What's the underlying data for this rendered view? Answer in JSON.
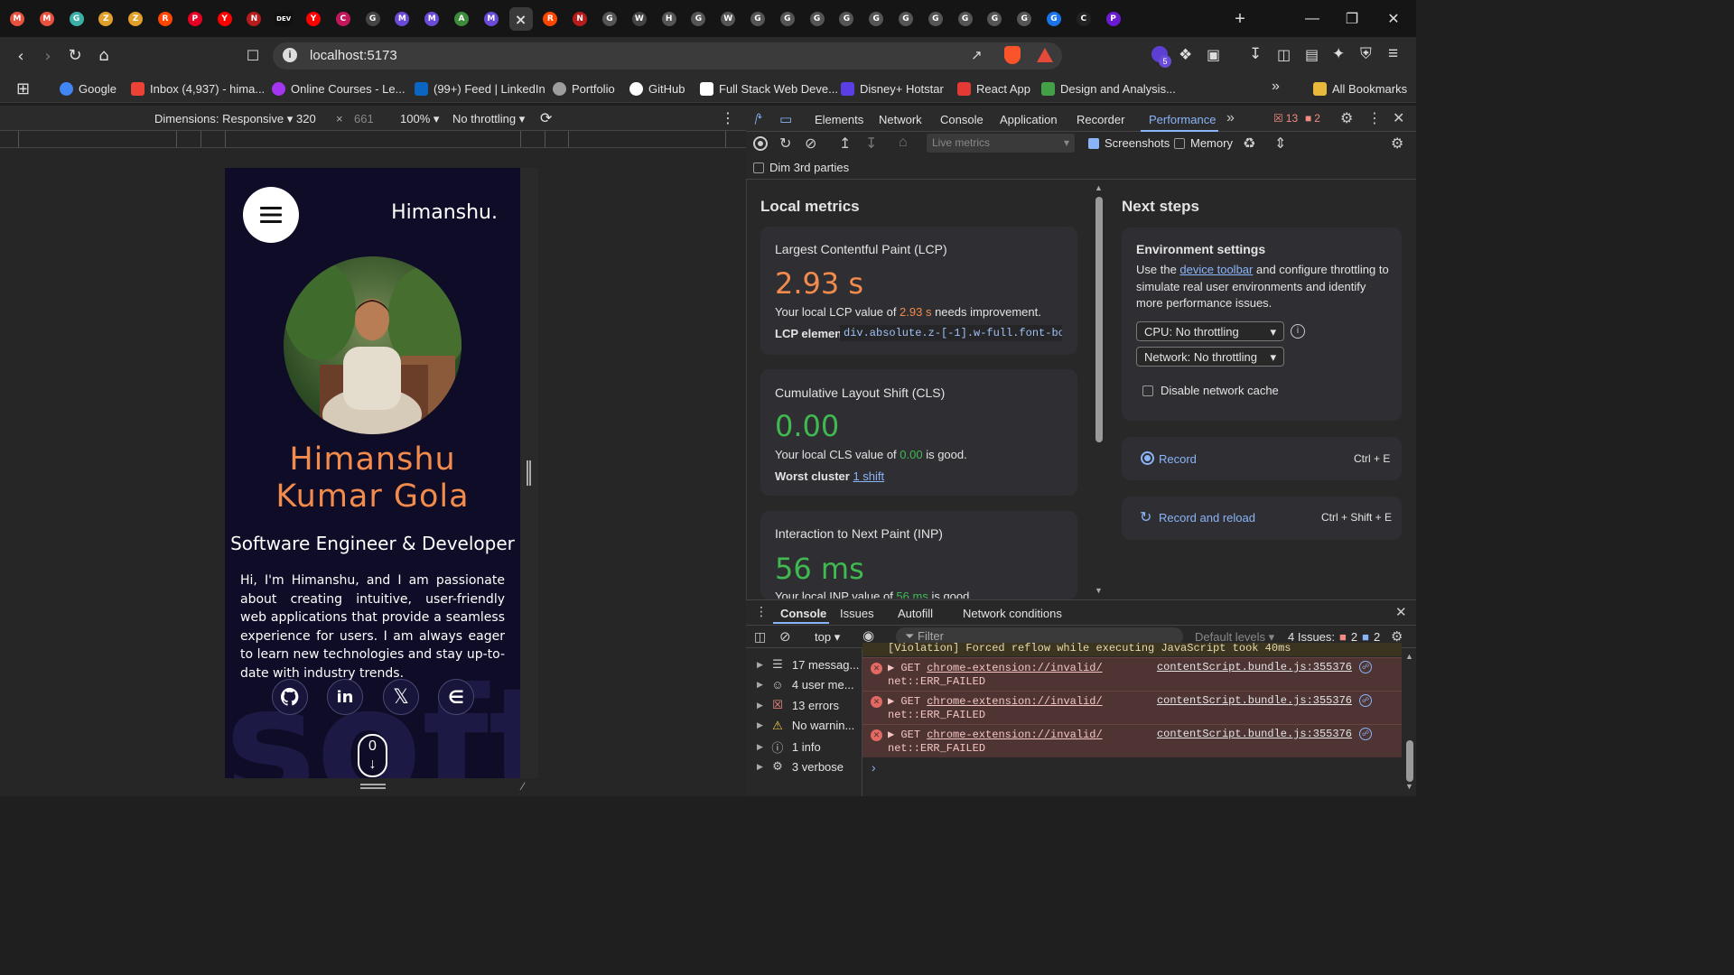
{
  "browser": {
    "url": "localhost:5173",
    "extension_badge": "5",
    "bookmarks": [
      {
        "label": "Google",
        "color": "#4285f4"
      },
      {
        "label": "Inbox (4,937) - hima...",
        "color": "#ea4335"
      },
      {
        "label": "Online Courses - Le...",
        "color": "#a435f0"
      },
      {
        "label": "(99+) Feed | LinkedIn",
        "color": "#0a66c2"
      },
      {
        "label": "Portfolio",
        "color": "#9e9e9e"
      },
      {
        "label": "GitHub",
        "color": "#ffffff"
      },
      {
        "label": "Full Stack Web Deve...",
        "color": "#ffffff"
      },
      {
        "label": "Disney+ Hotstar",
        "color": "#5b3ee5"
      },
      {
        "label": "React App",
        "color": "#e53935"
      },
      {
        "label": "Design and Analysis...",
        "color": "#43a047"
      }
    ],
    "all_bookmarks": "All Bookmarks",
    "tab_favicons": [
      "M",
      "M",
      "G",
      "Z",
      "Z",
      "R",
      "P",
      "Y",
      "N",
      "DEV",
      "Y",
      "C",
      "G",
      "M",
      "M",
      "A",
      "M",
      "×",
      "R",
      "N",
      "G",
      "W",
      "H",
      "G",
      "W",
      "G",
      "G",
      "G",
      "G",
      "G",
      "G",
      "G",
      "G",
      "G",
      "G",
      "G",
      "C",
      "P"
    ]
  },
  "device_toolbar": {
    "dimensions": "Dimensions: Responsive",
    "width": "320",
    "times": "×",
    "height": "661",
    "zoom": "100%",
    "throttling": "No throttling"
  },
  "site": {
    "brand": "Himanshu.",
    "name_line1": "Himanshu",
    "name_line2": "Kumar Gola",
    "role": "Software Engineer & Developer",
    "bio": "Hi, I'm Himanshu, and I am passionate about creating intuitive, user-friendly web applications that provide a seamless experience for users. I am always eager to learn new technologies and stay up-to-date with industry trends.",
    "socials": [
      "github-icon",
      "linkedin-icon",
      "x-icon",
      "codechef-icon"
    ],
    "scroll_hint": "0"
  },
  "devtools": {
    "tabs": [
      "Elements",
      "Network",
      "Console",
      "Application",
      "Recorder",
      "Performance"
    ],
    "active_tab": "Performance",
    "error_count": "13",
    "warning_count": "2",
    "live_metrics_placeholder": "Live metrics",
    "screenshots_label": "Screenshots",
    "memory_label": "Memory",
    "dim_3rd_parties": "Dim 3rd parties",
    "local_metrics": {
      "heading": "Local metrics",
      "lcp": {
        "title": "Largest Contentful Paint (LCP)",
        "value": "2.93 s",
        "text_pre": "Your local LCP value of ",
        "text_val": "2.93 s",
        "text_post": " needs improvement.",
        "element_label": "LCP element",
        "element_value": "div.absolute.z-[-1].w-full.font-bo…"
      },
      "cls": {
        "title": "Cumulative Layout Shift (CLS)",
        "value": "0.00",
        "text_pre": "Your local CLS value of ",
        "text_val": "0.00",
        "text_post": " is good.",
        "worst_label": "Worst cluster",
        "worst_value": "1 shift"
      },
      "inp": {
        "title": "Interaction to Next Paint (INP)",
        "value": "56 ms",
        "text_pre": "Your local INP value of ",
        "text_val": "56 ms",
        "text_post": " is good."
      }
    },
    "next_steps": {
      "heading": "Next steps",
      "env_title": "Environment settings",
      "env_text_pre": "Use the ",
      "env_link": "device toolbar",
      "env_text_post": " and configure throttling to simulate real user environments and identify more performance issues.",
      "cpu": "CPU: No throttling",
      "network": "Network: No throttling",
      "disable_cache": "Disable network cache",
      "record": "Record",
      "record_shortcut": "Ctrl + E",
      "record_reload": "Record and reload",
      "record_reload_shortcut": "Ctrl + Shift + E"
    },
    "drawer": {
      "tabs": [
        "Console",
        "Issues",
        "Autofill",
        "Network conditions"
      ],
      "context": "top",
      "filter_placeholder": "Filter",
      "levels": "Default levels",
      "issues_label": "4 Issues:",
      "issues_err": "2",
      "issues_info": "2",
      "violation_text": "[Violation] Forced reflow while executing JavaScript took 40ms",
      "sidebar": [
        {
          "label": "17 messag...",
          "icon": "list-icon"
        },
        {
          "label": "4 user me...",
          "icon": "user-icon"
        },
        {
          "label": "13 errors",
          "icon": "error-icon"
        },
        {
          "label": "No warnin...",
          "icon": "warning-icon"
        },
        {
          "label": "1 info",
          "icon": "info-icon"
        },
        {
          "label": "3 verbose",
          "icon": "bug-icon"
        }
      ],
      "errors": [
        {
          "method": "▶ GET",
          "url": "chrome-extension://invalid/",
          "msg": "net::ERR_FAILED",
          "source": "contentScript.bundle.js:355376"
        },
        {
          "method": "▶ GET",
          "url": "chrome-extension://invalid/",
          "msg": "net::ERR_FAILED",
          "source": "contentScript.bundle.js:355376"
        },
        {
          "method": "▶ GET",
          "url": "chrome-extension://invalid/",
          "msg": "net::ERR_FAILED",
          "source": "contentScript.bundle.js:355376"
        }
      ]
    }
  },
  "colors": {
    "accent_orange": "#f28b4b",
    "good_green": "#3fb950",
    "link_blue": "#8ab4f8"
  }
}
